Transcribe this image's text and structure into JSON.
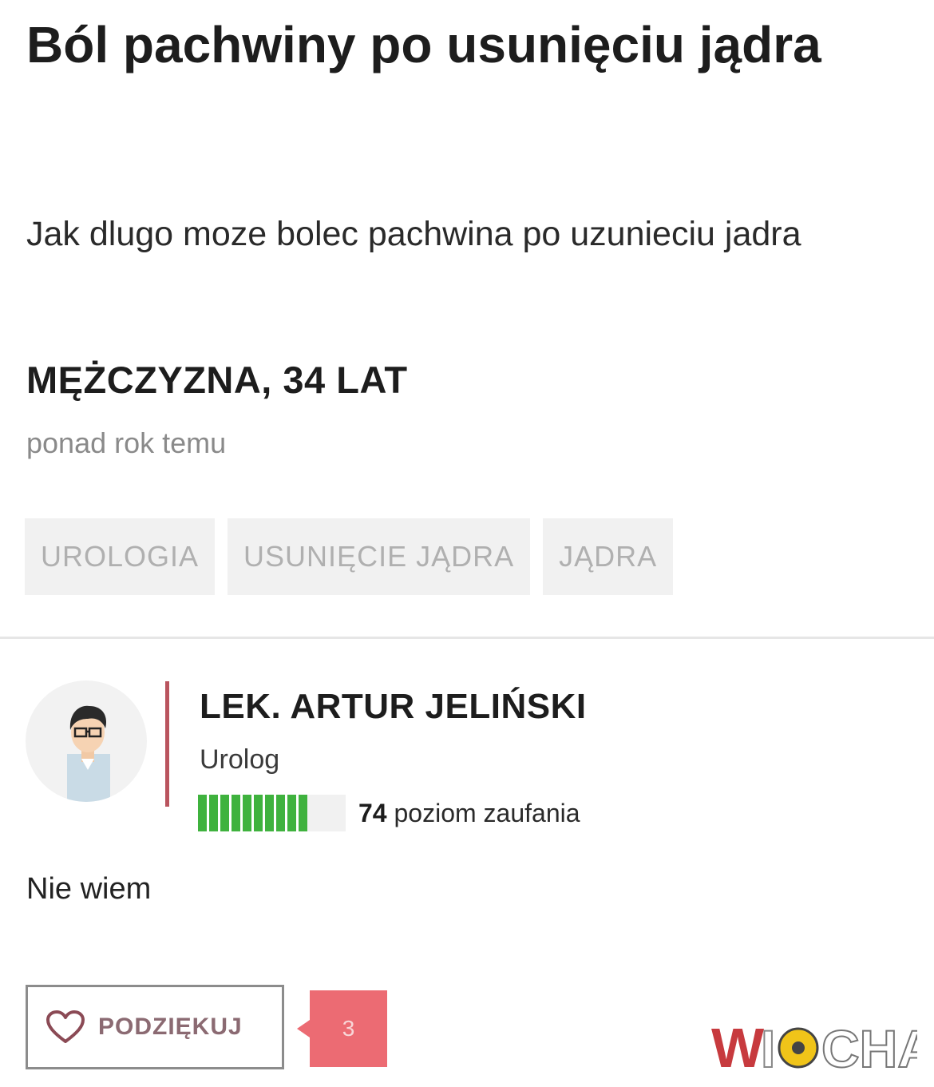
{
  "question": {
    "title": "Ból pachwiny po usunięciu jądra",
    "body": "Jak dlugo moze bolec pachwina po uzunieciu jadra",
    "author_info": "MĘŻCZYZNA, 34 LAT",
    "posted": "ponad rok temu",
    "tags": [
      "UROLOGIA",
      "USUNIĘCIE JĄDRA",
      "JĄDRA"
    ]
  },
  "answer": {
    "doctor_name": "LEK. ARTUR JELIŃSKI",
    "specialty": "Urolog",
    "trust_level": 74,
    "trust_label": "poziom zaufania",
    "text": "Nie wiem",
    "thanks_label": "PODZIĘKUJ",
    "thanks_count": "3"
  },
  "watermark": {
    "text": "WIOCHA"
  },
  "colors": {
    "accent_bar": "#b9545e",
    "trust_green": "#3fb23e",
    "count_badge": "#ec6b73"
  },
  "icons": [
    "avatar-doctor-illustration",
    "heart-outline-icon"
  ]
}
